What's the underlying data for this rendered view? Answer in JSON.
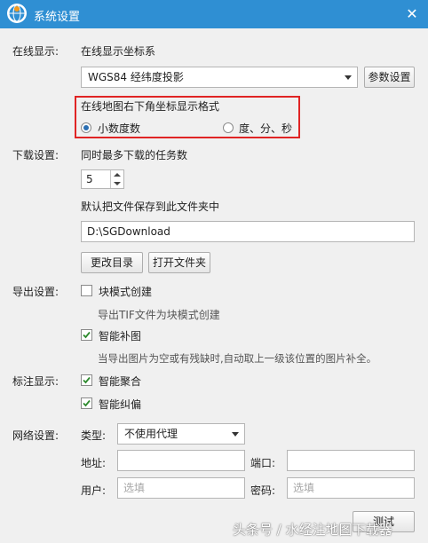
{
  "window": {
    "title": "系统设置",
    "close_glyph": "✕",
    "icon": "globe-icon"
  },
  "online_display": {
    "section_label": "在线显示:",
    "coord_label": "在线显示坐标系",
    "coord_value": "WGS84 经纬度投影",
    "param_button": "参数设置",
    "format_label": "在线地图右下角坐标显示格式",
    "format_options": [
      "小数度数",
      "度、分、秒"
    ],
    "format_selected": "小数度数"
  },
  "download": {
    "section_label": "下载设置:",
    "max_tasks_label": "同时最多下载的任务数",
    "max_tasks_value": "5",
    "save_folder_label": "默认把文件保存到此文件夹中",
    "save_folder_value": "D:\\SGDownload",
    "change_dir_button": "更改目录",
    "open_folder_button": "打开文件夹"
  },
  "export": {
    "section_label": "导出设置:",
    "block_mode_label": "块模式创建",
    "block_mode_checked": false,
    "block_mode_hint": "导出TIF文件为块模式创建",
    "smart_fill_label": "智能补图",
    "smart_fill_checked": true,
    "smart_fill_hint": "当导出图片为空或有残缺时,自动取上一级该位置的图片补全。"
  },
  "annotation": {
    "section_label": "标注显示:",
    "smart_merge_label": "智能聚合",
    "smart_merge_checked": true,
    "smart_correct_label": "智能纠偏",
    "smart_correct_checked": true
  },
  "network": {
    "section_label": "网络设置:",
    "type_label": "类型:",
    "type_value": "不使用代理",
    "address_label": "地址:",
    "address_value": "",
    "port_label": "端口:",
    "port_value": "",
    "user_label": "用户:",
    "user_placeholder": "选填",
    "password_label": "密码:",
    "password_placeholder": "选填",
    "test_button": "测试"
  },
  "watermark": "头条号 / 水经注地图下载器",
  "colors": {
    "titlebar": "#2f8fd3",
    "highlight_border": "#e02424",
    "window_bg": "#f0f0f0"
  }
}
